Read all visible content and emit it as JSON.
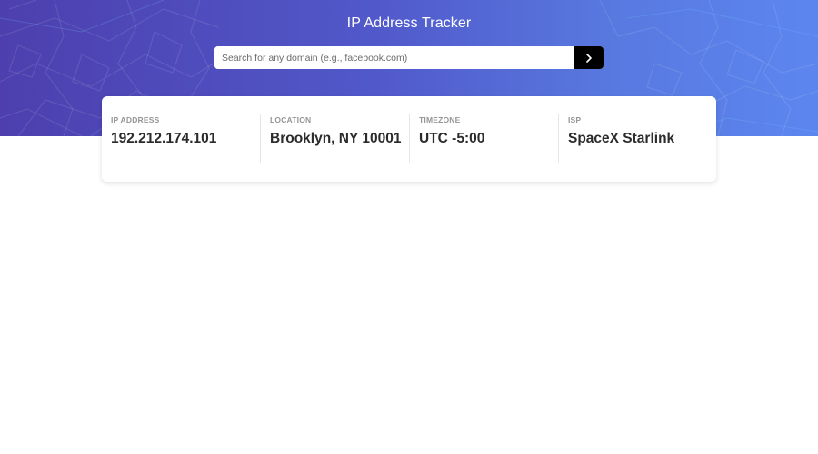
{
  "header": {
    "title": "IP Address Tracker"
  },
  "search": {
    "placeholder": "Search for any domain (e.g., facebook.com)",
    "value": "",
    "button_icon": "chevron-right-icon"
  },
  "info": [
    {
      "label": "IP ADDRESS",
      "value": "192.212.174.101"
    },
    {
      "label": "LOCATION",
      "value": "Brooklyn, NY 10001"
    },
    {
      "label": "TIMEZONE",
      "value": "UTC -5:00"
    },
    {
      "label": "ISP",
      "value": "SpaceX Starlink"
    }
  ],
  "colors": {
    "hero_start": "#4d3fae",
    "hero_end": "#5c86ef",
    "button": "#000000",
    "label": "#959595",
    "value": "#2b2b2b"
  }
}
